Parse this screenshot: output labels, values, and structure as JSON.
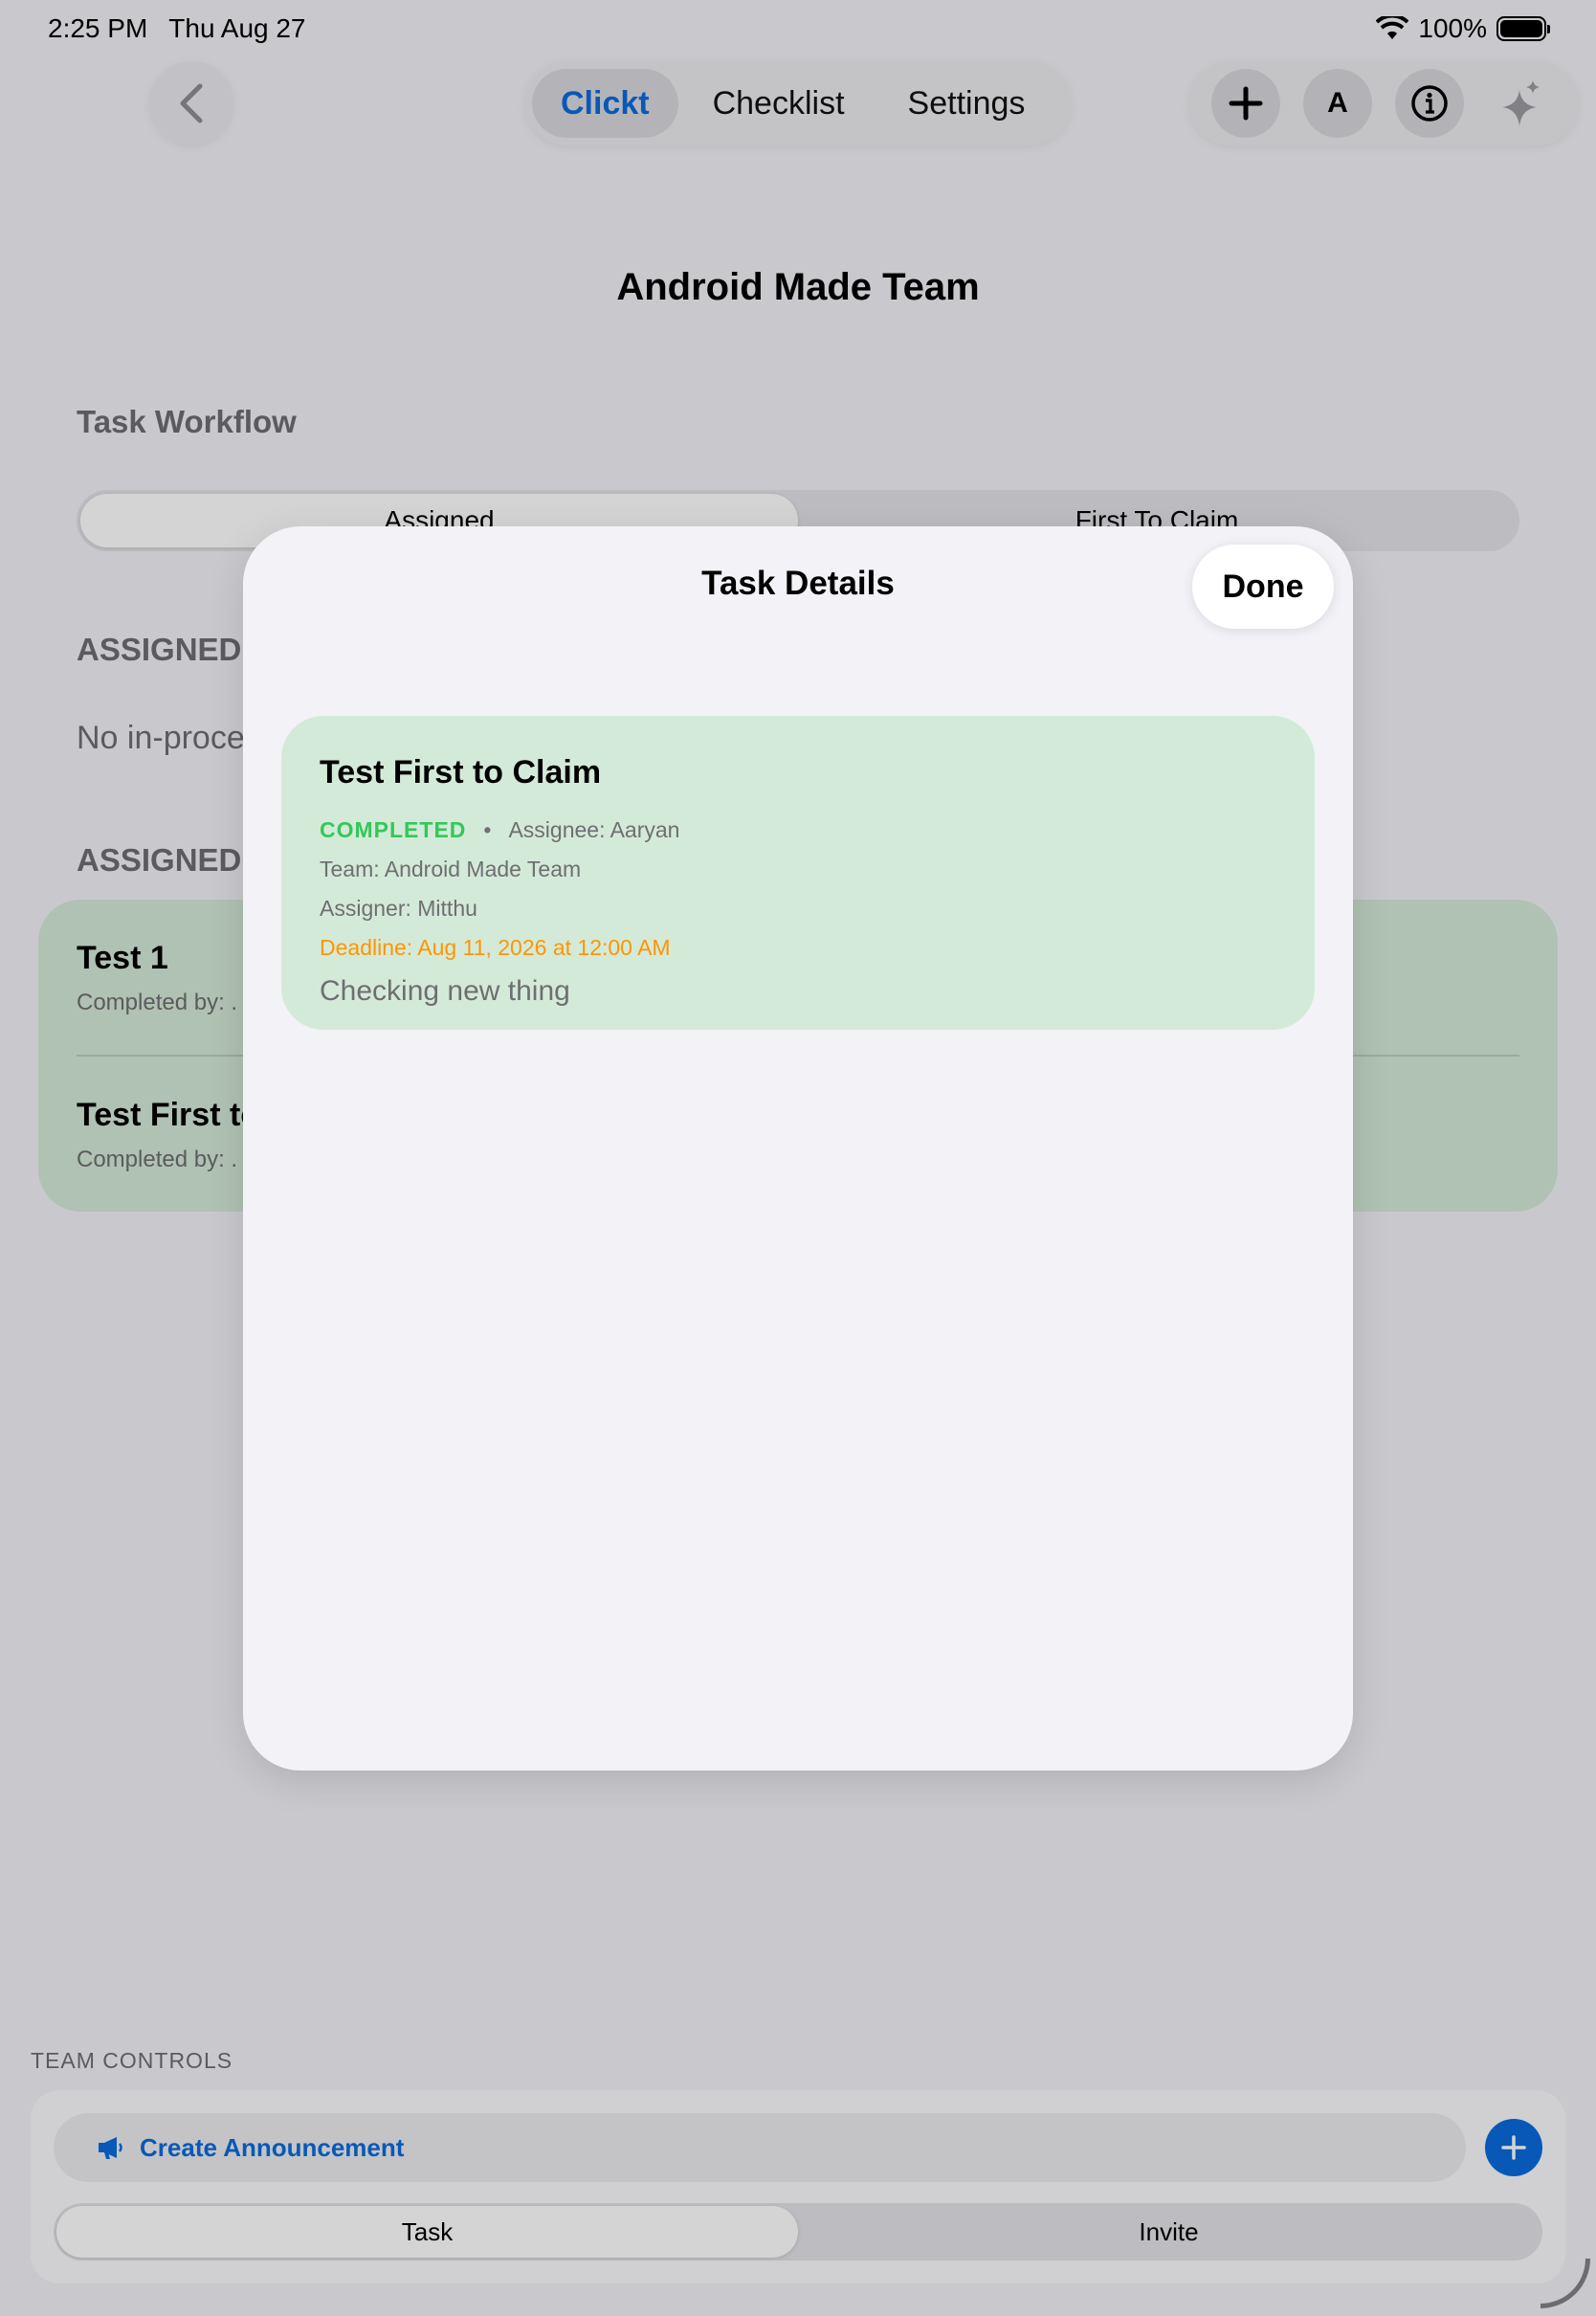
{
  "status_bar": {
    "time": "2:25 PM",
    "date": "Thu Aug 27",
    "battery": "100%"
  },
  "nav": {
    "tabs": [
      {
        "label": "Clickt",
        "active": true
      },
      {
        "label": "Checklist",
        "active": false
      },
      {
        "label": "Settings",
        "active": false
      }
    ],
    "avatar_letter": "A"
  },
  "page_title": "Android Made Team",
  "workflow": {
    "heading": "Task Workflow",
    "options": [
      "Assigned",
      "First To Claim"
    ],
    "selected": "Assigned"
  },
  "assigned_in_process": {
    "heading": "ASSIGNED",
    "empty_text": "No in-proce"
  },
  "assigned_completed": {
    "heading": "ASSIGNED",
    "rows": [
      {
        "title": "Test 1",
        "sub": "Completed by: ."
      },
      {
        "title": "Test First to",
        "sub": "Completed by: ."
      }
    ]
  },
  "team_controls": {
    "label": "TEAM CONTROLS",
    "announcement_label": "Create Announcement",
    "tabs": [
      "Task",
      "Invite"
    ],
    "selected_tab": "Task"
  },
  "modal": {
    "title": "Task Details",
    "done_label": "Done",
    "task": {
      "title": "Test First to Claim",
      "status": "COMPLETED",
      "separator": "•",
      "assignee": "Assignee: Aaryan",
      "team": "Team: Android Made Team",
      "assigner": "Assigner: Mitthu",
      "deadline": "Deadline: Aug 11, 2026 at 12:00 AM",
      "description": "Checking new thing"
    }
  },
  "colors": {
    "accent": "#0a6cdc",
    "card_green": "#d4ead8",
    "status_completed": "#34c759",
    "deadline": "#ff9500"
  }
}
